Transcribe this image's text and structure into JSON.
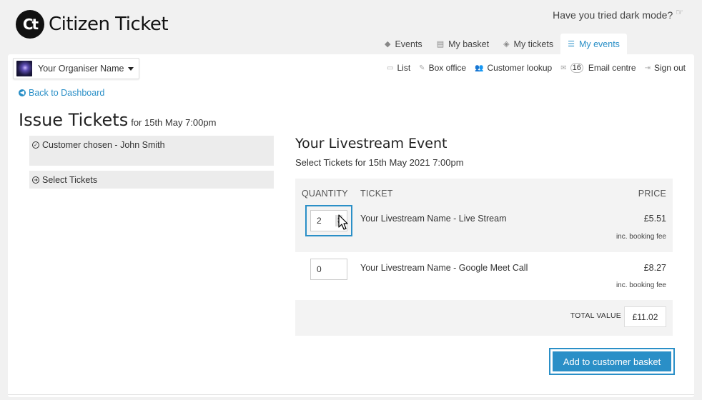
{
  "brand": {
    "mark": "Ct",
    "name": "Citizen Ticket"
  },
  "dark_mode": {
    "text": "Have you tried dark mode?"
  },
  "top_tabs": [
    {
      "label": "Events",
      "icon": "tag-icon"
    },
    {
      "label": "My basket",
      "icon": "basket-icon"
    },
    {
      "label": "My tickets",
      "icon": "ticket-icon"
    },
    {
      "label": "My events",
      "icon": "sliders-icon",
      "active": true
    }
  ],
  "organiser": {
    "name": "Your Organiser Name"
  },
  "sub_nav": {
    "list": "List",
    "box_office": "Box office",
    "customer_lookup": "Customer lookup",
    "email_badge": "16",
    "email_centre": "Email centre",
    "sign_out": "Sign out"
  },
  "back_link": "Back to Dashboard",
  "page": {
    "title": "Issue Tickets",
    "subtitle": "for 15th May 7:00pm"
  },
  "steps": {
    "customer": "Customer chosen - John Smith",
    "tickets": "Select Tickets"
  },
  "event": {
    "title": "Your Livestream Event",
    "subtitle": "Select Tickets for 15th May 2021 7:00pm"
  },
  "table": {
    "headers": {
      "quantity": "QUANTITY",
      "ticket": "TICKET",
      "price": "PRICE"
    },
    "rows": [
      {
        "qty": "2",
        "name": "Your Livestream Name - Live Stream",
        "price": "£5.51",
        "fee": "inc. booking fee"
      },
      {
        "qty": "0",
        "name": "Your Livestream Name - Google Meet Call",
        "price": "£8.27",
        "fee": "inc. booking fee"
      }
    ],
    "total_label": "TOTAL VALUE",
    "total_value": "£11.02"
  },
  "actions": {
    "add_to_basket": "Add to customer basket"
  },
  "colors": {
    "accent": "#2a8fc7",
    "background": "#f1f1f1"
  }
}
